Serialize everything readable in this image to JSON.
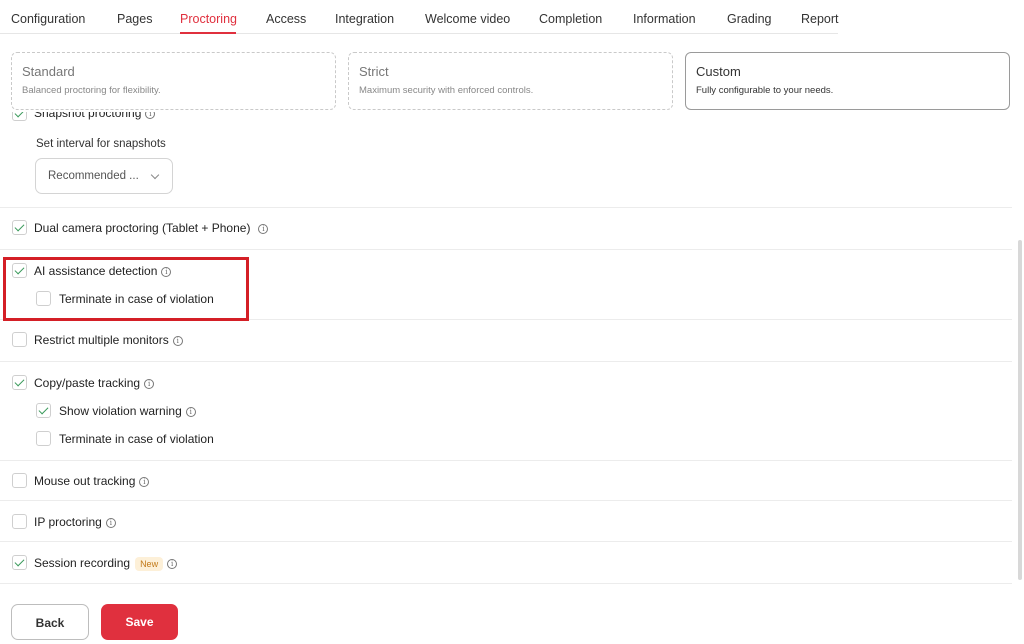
{
  "tabs": [
    {
      "label": "Configuration"
    },
    {
      "label": "Pages"
    },
    {
      "label": "Proctoring"
    },
    {
      "label": "Access"
    },
    {
      "label": "Integration"
    },
    {
      "label": "Welcome video"
    },
    {
      "label": "Completion"
    },
    {
      "label": "Information"
    },
    {
      "label": "Grading"
    },
    {
      "label": "Report"
    }
  ],
  "active_tab": "Proctoring",
  "presets": [
    {
      "title": "Standard",
      "desc": "Balanced proctoring for flexibility."
    },
    {
      "title": "Strict",
      "desc": "Maximum security with enforced controls."
    },
    {
      "title": "Custom",
      "desc": "Fully configurable to your needs."
    }
  ],
  "selected_preset": "Custom",
  "snapshot": {
    "label": "Snapshot proctoring",
    "checked": true,
    "interval_label": "Set interval for snapshots",
    "interval_value": "Recommended ..."
  },
  "dual_camera": {
    "label": "Dual camera proctoring (Tablet + Phone)",
    "checked": true
  },
  "ai_detection": {
    "label": "AI assistance detection",
    "checked": true,
    "terminate_label": "Terminate in case of violation",
    "terminate_checked": false
  },
  "multi_monitor": {
    "label": "Restrict multiple monitors",
    "checked": false
  },
  "copy_paste": {
    "label": "Copy/paste tracking",
    "checked": true,
    "warning_label": "Show violation warning",
    "warning_checked": true,
    "terminate_label": "Terminate in case of violation",
    "terminate_checked": false
  },
  "mouse_out": {
    "label": "Mouse out tracking",
    "checked": false
  },
  "ip_proctoring": {
    "label": "IP proctoring",
    "checked": false
  },
  "session_recording": {
    "label": "Session recording",
    "badge": "New",
    "checked": true
  },
  "info_icon_glyph": "i",
  "buttons": {
    "back": "Back",
    "save": "Save"
  },
  "colors": {
    "accent": "#e0303e",
    "check": "#3a9a5b",
    "badge_bg": "#fdf0d8",
    "badge_text": "#c27a1a",
    "highlight": "#d41f26"
  }
}
